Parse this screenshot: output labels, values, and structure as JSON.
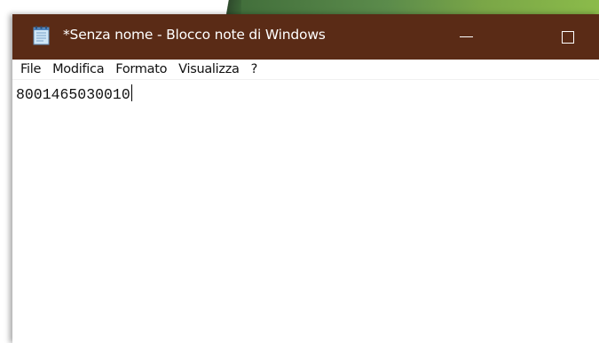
{
  "window": {
    "title": "*Senza nome - Blocco note di Windows",
    "app_icon": "notepad-icon",
    "titlebar_color": "#5a2b16",
    "controls": {
      "minimize_icon": "minimize-icon",
      "maximize_icon": "maximize-icon"
    }
  },
  "menubar": {
    "items": [
      {
        "label": "File"
      },
      {
        "label": "Modifica"
      },
      {
        "label": "Formato"
      },
      {
        "label": "Visualizza"
      },
      {
        "label": "?"
      }
    ]
  },
  "editor": {
    "content": "8001465030010"
  }
}
